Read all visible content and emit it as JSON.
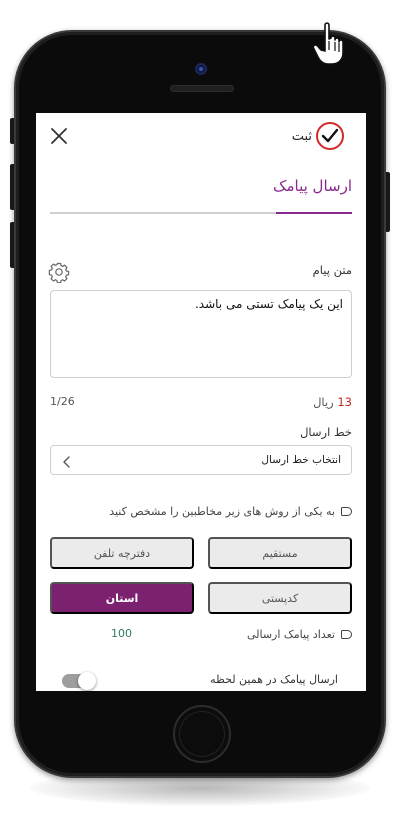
{
  "header": {
    "confirm_label": "ثبت",
    "close_icon": "close-icon",
    "confirm_icon": "checkmark-icon",
    "accent_color": "#8b2a8e",
    "confirm_ring_color": "#d42a2a"
  },
  "tabs": {
    "active_label": "ارسال پیامک"
  },
  "message": {
    "label": "متن پیام",
    "value": "این یک پیامک تستی می باشد.",
    "settings_icon": "gear-icon"
  },
  "cost": {
    "amount": "13",
    "unit": "ریال",
    "counter": "1/26"
  },
  "send_line": {
    "label": "خط ارسال",
    "selected": "انتخاب خط ارسال"
  },
  "recipients": {
    "prompt": "به یکی از روش های زیر مخاطبین را مشخص کنید",
    "options": [
      {
        "label": "مستقیم"
      },
      {
        "label": "دفترچه تلفن"
      },
      {
        "label": "کدپستی"
      },
      {
        "label": "استان"
      }
    ],
    "active_color": "#7b2170"
  },
  "send_count": {
    "label": "تعداد پیامک ارسالی",
    "value": "100"
  },
  "schedule": {
    "label": "ارسال پیامک در همین لحظه",
    "toggle_on": false
  }
}
